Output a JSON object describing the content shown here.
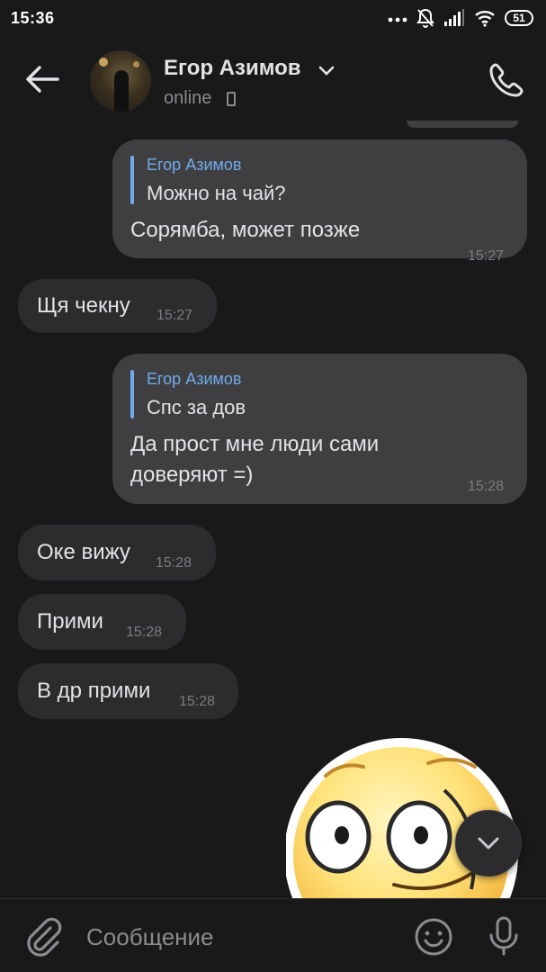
{
  "status_bar": {
    "time": "15:36",
    "battery": "51"
  },
  "header": {
    "contact_name": "Егор Азимов",
    "contact_status": "online"
  },
  "messages": [
    {
      "direction": "out",
      "reply_author": "Егор Азимов",
      "reply_text": "Можно на чай?",
      "text": "Сорямба, может позже",
      "time": "15:27"
    },
    {
      "direction": "in",
      "text": "Щя чекну",
      "time": "15:27"
    },
    {
      "direction": "out",
      "reply_author": "Егор Азимов",
      "reply_text": "Спс за дов",
      "text_line1": "Да прост мне люди сами",
      "text_line2": "доверяют =)",
      "time": "15:28"
    },
    {
      "direction": "in",
      "text": "Оке вижу",
      "time": "15:28"
    },
    {
      "direction": "in",
      "text": "Прими",
      "time": "15:28"
    },
    {
      "direction": "in",
      "text": "В др прими",
      "time": "15:28"
    }
  ],
  "composer": {
    "placeholder": "Сообщение"
  },
  "colors": {
    "background": "#19191a",
    "bubble_out": "#3f3f41",
    "bubble_in": "#2c2c2e",
    "accent": "#71aaeb"
  }
}
